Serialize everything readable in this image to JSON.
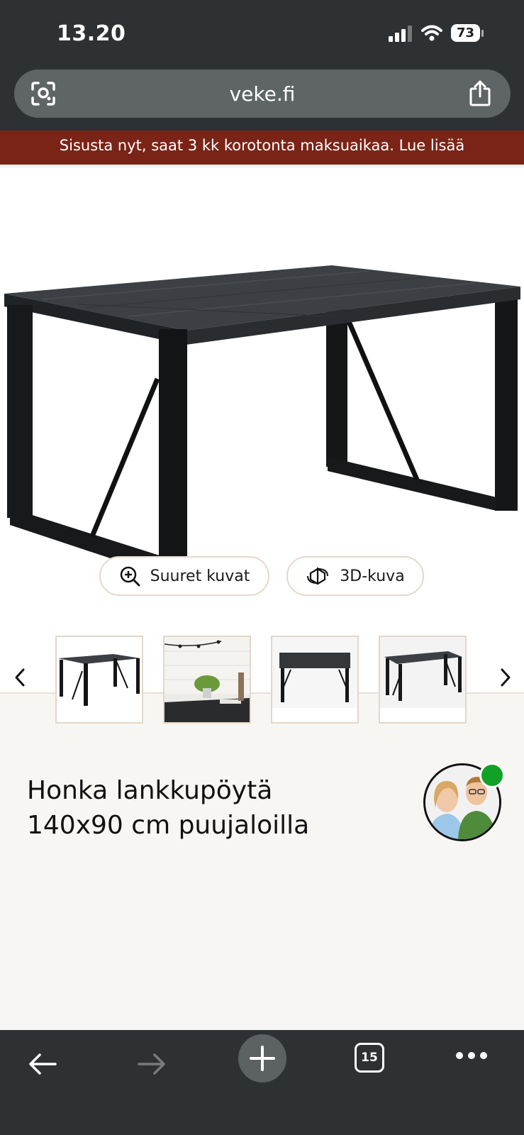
{
  "status_bar": {
    "time": "13.20",
    "battery": "73"
  },
  "browser": {
    "url": "veke.fi",
    "tab_count": "15"
  },
  "promo": {
    "text": "Sisusta nyt, saat 3 kk korotonta maksuaikaa. Lue lisää"
  },
  "gallery": {
    "large_images_label": "Suuret kuvat",
    "view_3d_label": "3D-kuva"
  },
  "product": {
    "title_line1": "Honka lankkupöytä",
    "title_line2": "140x90 cm puujaloilla"
  },
  "colors": {
    "promo_bg": "#7a2417",
    "chrome_bg": "#2e3134",
    "online": "#12a127"
  },
  "icons": [
    "wifi-icon",
    "signal-icon",
    "scan-icon",
    "share-icon",
    "zoom-icon",
    "rotate-3d-icon",
    "chevron-left-icon",
    "chevron-right-icon",
    "back-icon",
    "forward-icon",
    "plus-icon",
    "more-icon"
  ]
}
